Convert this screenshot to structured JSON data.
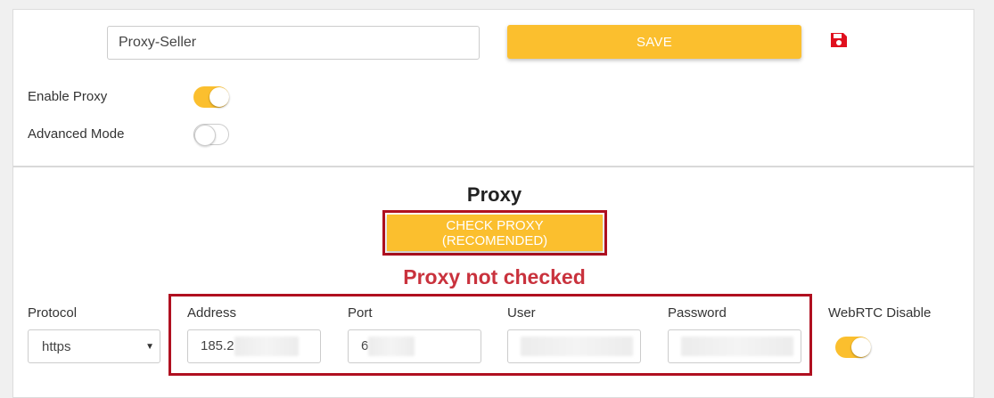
{
  "profile": {
    "name_value": "Proxy-Seller",
    "save_label": "SAVE"
  },
  "toggles": {
    "enable_proxy_label": "Enable Proxy",
    "enable_proxy_on": true,
    "advanced_mode_label": "Advanced Mode",
    "advanced_mode_on": false
  },
  "proxy": {
    "title": "Proxy",
    "check_label": "CHECK PROXY (RECOMENDED)",
    "status": "Proxy not checked",
    "protocol_label": "Protocol",
    "protocol_value": "https",
    "address_label": "Address",
    "address_value": "185.2",
    "port_label": "Port",
    "port_value": "6",
    "user_label": "User",
    "password_label": "Password",
    "webrtc_label": "WebRTC Disable",
    "webrtc_on": true
  },
  "colors": {
    "accent": "#fbbf2e",
    "highlight_border": "#b01020",
    "status_red": "#c9323d",
    "save_icon": "#e0101e"
  },
  "icons": {
    "save": "floppy-disk-icon",
    "dropdown": "caret-down-icon"
  }
}
